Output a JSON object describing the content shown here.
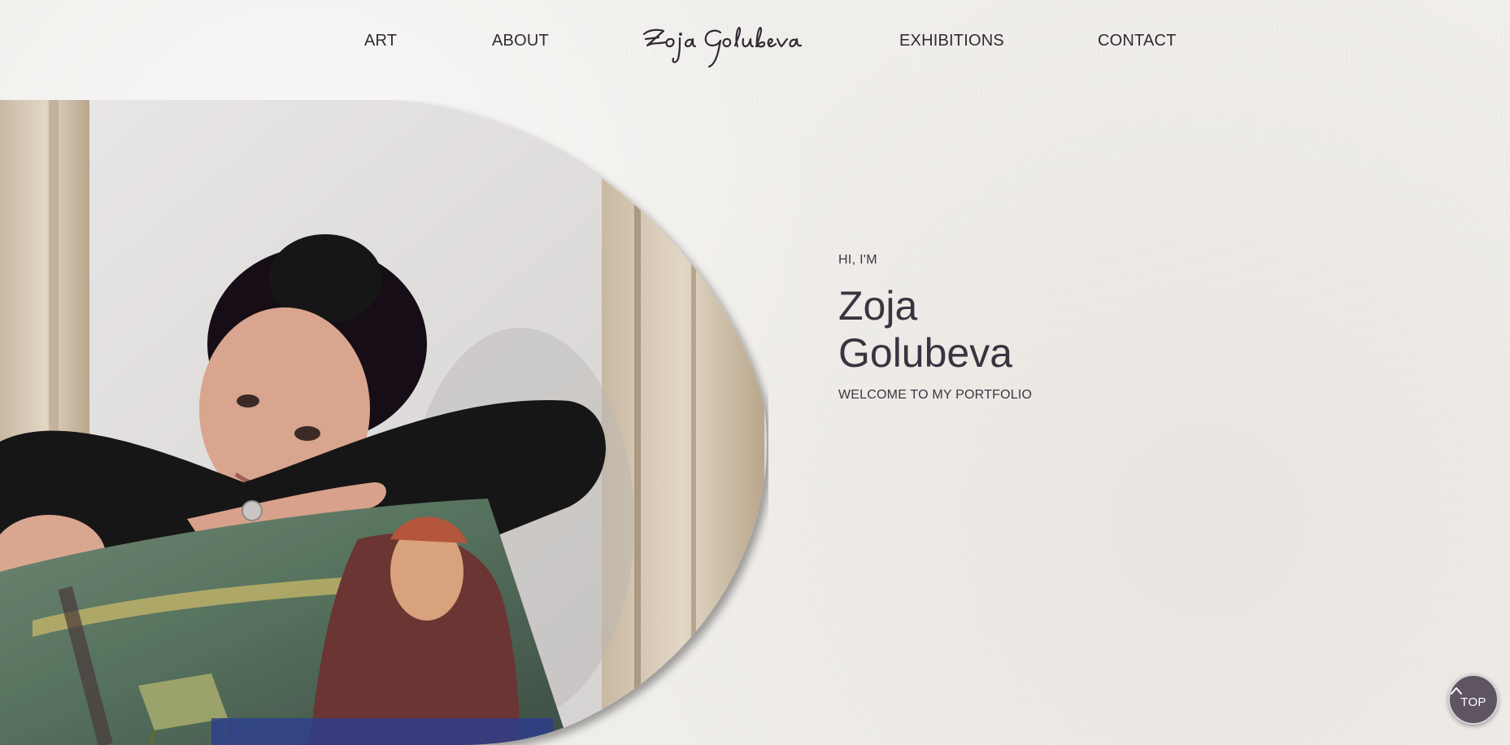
{
  "nav": {
    "items": [
      {
        "label": "ART"
      },
      {
        "label": "ABOUT"
      },
      {
        "label": "EXHIBITIONS"
      },
      {
        "label": "CONTACT"
      }
    ],
    "logo_text": "Zoja Golubeva"
  },
  "hero": {
    "greeting": "HI, I'M",
    "first_name": "Zoja",
    "last_name": "Golubeva",
    "subtitle": "WELCOME TO MY PORTFOLIO",
    "image_icon": "artist-portrait-photo"
  },
  "top_button": {
    "label": "TOP",
    "icon": "chevron-up-icon"
  },
  "colors": {
    "background": "#f1efec",
    "text": "#3a3340",
    "button": "#5f5461"
  }
}
